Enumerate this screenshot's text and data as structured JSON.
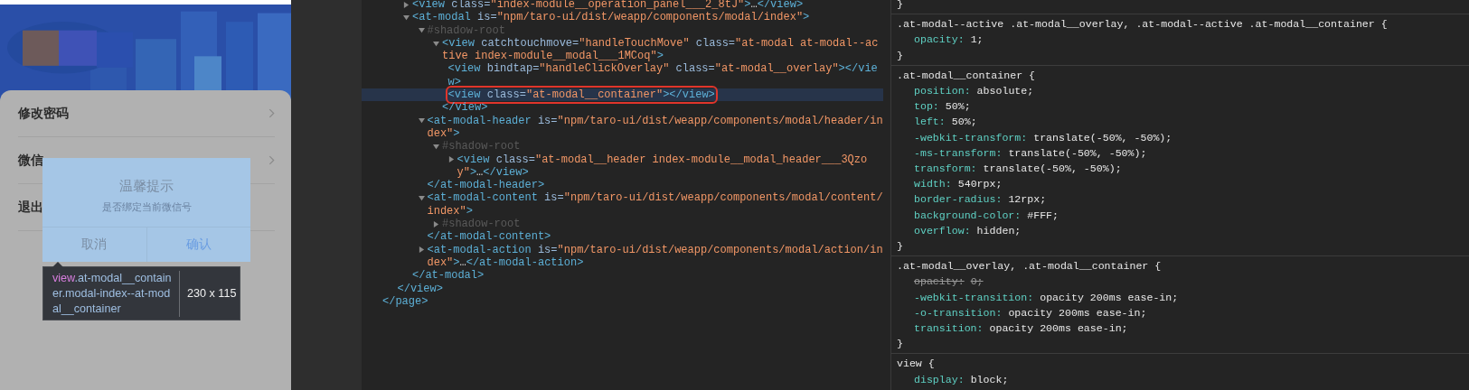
{
  "phone": {
    "menu": [
      {
        "label": "修改密码",
        "chevron": true
      },
      {
        "label": "微信",
        "chevron": true
      },
      {
        "label": "退出",
        "chevron": false
      }
    ],
    "modal": {
      "title": "温馨提示",
      "message": "是否绑定当前微信号",
      "buttons": [
        {
          "label": "取消",
          "kind": "cancel"
        },
        {
          "label": "确认",
          "kind": "confirm"
        }
      ]
    },
    "inspect_tooltip": {
      "tag": "view",
      "selector": ".at-modal__container.modal-index--at-modal__container",
      "size": "230 x 115"
    }
  },
  "elements": {
    "nodes": [
      {
        "close": "</page>",
        "children": [
          {
            "close": "</view>",
            "children": [
              {
                "expanded": false,
                "selected": false,
                "parts": [
                  {
                    "kind": "tag",
                    "text": "<view"
                  },
                  {
                    "kind": "attr",
                    "text": " class="
                  },
                  {
                    "kind": "value",
                    "text": "\"index-module__operation_panel___2_8tJ\""
                  },
                  {
                    "kind": "tag",
                    "text": ">"
                  },
                  {
                    "kind": "text",
                    "text": "…"
                  },
                  {
                    "kind": "tag",
                    "text": "</view>"
                  }
                ]
              },
              {
                "expanded": true,
                "selected": false,
                "parts": [
                  {
                    "kind": "tag",
                    "text": "<at-modal"
                  },
                  {
                    "kind": "attr",
                    "text": " is="
                  },
                  {
                    "kind": "value",
                    "text": "\"npm/taro-ui/dist/weapp/components/modal/index\""
                  },
                  {
                    "kind": "tag",
                    "text": ">"
                  }
                ],
                "close": "</at-modal>",
                "children": [
                  {
                    "expanded": true,
                    "selected": false,
                    "parts": [
                      {
                        "kind": "comment",
                        "text": "#shadow-root"
                      }
                    ],
                    "children": [
                      {
                        "expanded": true,
                        "selected": false,
                        "parts": [
                          {
                            "kind": "tag",
                            "text": "<view"
                          },
                          {
                            "kind": "attr",
                            "text": " catchtouchmove="
                          },
                          {
                            "kind": "value",
                            "text": "\"handleTouchMove\""
                          },
                          {
                            "kind": "attr",
                            "text": " class="
                          },
                          {
                            "kind": "value",
                            "text": "\"at-modal at-modal--active index-module__modal___1MCoq\""
                          },
                          {
                            "kind": "tag",
                            "text": ">"
                          }
                        ],
                        "close": "</view>",
                        "children": [
                          {
                            "selected": false,
                            "parts": [
                              {
                                "kind": "tag",
                                "text": "<view"
                              },
                              {
                                "kind": "attr",
                                "text": " bindtap="
                              },
                              {
                                "kind": "value",
                                "text": "\"handleClickOverlay\""
                              },
                              {
                                "kind": "attr",
                                "text": " class="
                              },
                              {
                                "kind": "value",
                                "text": "\"at-modal__overlay\""
                              },
                              {
                                "kind": "tag",
                                "text": "></view>"
                              }
                            ]
                          },
                          {
                            "selected": true,
                            "parts": [
                              {
                                "kind": "tag",
                                "text": "<view"
                              },
                              {
                                "kind": "attr",
                                "text": " class="
                              },
                              {
                                "kind": "value",
                                "text": "\"at-modal__container\""
                              },
                              {
                                "kind": "tag",
                                "text": "></view>"
                              }
                            ]
                          }
                        ]
                      }
                    ]
                  },
                  {
                    "expanded": true,
                    "selected": false,
                    "parts": [
                      {
                        "kind": "tag",
                        "text": "<at-modal-header"
                      },
                      {
                        "kind": "attr",
                        "text": " is="
                      },
                      {
                        "kind": "value",
                        "text": "\"npm/taro-ui/dist/weapp/components/modal/header/index\""
                      },
                      {
                        "kind": "tag",
                        "text": ">"
                      }
                    ],
                    "close": "</at-modal-header>",
                    "children": [
                      {
                        "expanded": true,
                        "selected": false,
                        "parts": [
                          {
                            "kind": "comment",
                            "text": "#shadow-root"
                          }
                        ],
                        "children": [
                          {
                            "expanded": false,
                            "selected": false,
                            "parts": [
                              {
                                "kind": "tag",
                                "text": "<view"
                              },
                              {
                                "kind": "attr",
                                "text": " class="
                              },
                              {
                                "kind": "value",
                                "text": "\"at-modal__header index-module__modal_header___3Qzoy\""
                              },
                              {
                                "kind": "tag",
                                "text": ">"
                              },
                              {
                                "kind": "text",
                                "text": "…"
                              },
                              {
                                "kind": "tag",
                                "text": "</view>"
                              }
                            ]
                          }
                        ]
                      }
                    ]
                  },
                  {
                    "expanded": true,
                    "selected": false,
                    "parts": [
                      {
                        "kind": "tag",
                        "text": "<at-modal-content"
                      },
                      {
                        "kind": "attr",
                        "text": " is="
                      },
                      {
                        "kind": "value",
                        "text": "\"npm/taro-ui/dist/weapp/components/modal/content/index\""
                      },
                      {
                        "kind": "tag",
                        "text": ">"
                      }
                    ],
                    "close": "</at-modal-content>",
                    "children": [
                      {
                        "expanded": false,
                        "selected": false,
                        "parts": [
                          {
                            "kind": "comment",
                            "text": "#shadow-root"
                          }
                        ]
                      }
                    ]
                  },
                  {
                    "expanded": false,
                    "selected": false,
                    "parts": [
                      {
                        "kind": "tag",
                        "text": "<at-modal-action"
                      },
                      {
                        "kind": "attr",
                        "text": " is="
                      },
                      {
                        "kind": "value",
                        "text": "\"npm/taro-ui/dist/weapp/components/modal/action/index\""
                      },
                      {
                        "kind": "tag",
                        "text": ">"
                      },
                      {
                        "kind": "text",
                        "text": "…"
                      },
                      {
                        "kind": "tag",
                        "text": "</at-modal-action>"
                      }
                    ]
                  }
                ]
              }
            ]
          }
        ]
      }
    ]
  },
  "styles": {
    "rules": [
      {
        "close": "}"
      },
      {
        "selector": ".at-modal--active .at-modal__overlay, .at-modal--active .at-modal__container {",
        "close": "}",
        "properties": [
          {
            "name": "opacity:",
            "value": "1;",
            "overridden": false
          }
        ]
      },
      {
        "selector": ".at-modal__container {",
        "close": "}",
        "properties": [
          {
            "name": "position:",
            "value": "absolute;",
            "overridden": false
          },
          {
            "name": "top:",
            "value": "50%;",
            "overridden": false
          },
          {
            "name": "left:",
            "value": "50%;",
            "overridden": false
          },
          {
            "name": "-webkit-transform:",
            "value": "translate(-50%, -50%);",
            "overridden": false
          },
          {
            "name": "-ms-transform:",
            "value": "translate(-50%, -50%);",
            "overridden": false
          },
          {
            "name": "transform:",
            "value": "translate(-50%, -50%);",
            "overridden": false
          },
          {
            "name": "width:",
            "value": "540rpx;",
            "overridden": false
          },
          {
            "name": "border-radius:",
            "value": "12rpx;",
            "overridden": false
          },
          {
            "name": "background-color:",
            "value": "#FFF;",
            "overridden": false
          },
          {
            "name": "overflow:",
            "value": "hidden;",
            "overridden": false
          }
        ]
      },
      {
        "selector": ".at-modal__overlay, .at-modal__container {",
        "close": "}",
        "properties": [
          {
            "name": "opacity:",
            "value": "0;",
            "overridden": true
          },
          {
            "name": "-webkit-transition:",
            "value": "opacity 200ms ease-in;",
            "overridden": false
          },
          {
            "name": "-o-transition:",
            "value": "opacity 200ms ease-in;",
            "overridden": false
          },
          {
            "name": "transition:",
            "value": "opacity 200ms ease-in;",
            "overridden": false
          }
        ]
      },
      {
        "selector": "view {",
        "properties": [
          {
            "name": "display:",
            "value": "block;",
            "overridden": false
          }
        ]
      }
    ]
  }
}
